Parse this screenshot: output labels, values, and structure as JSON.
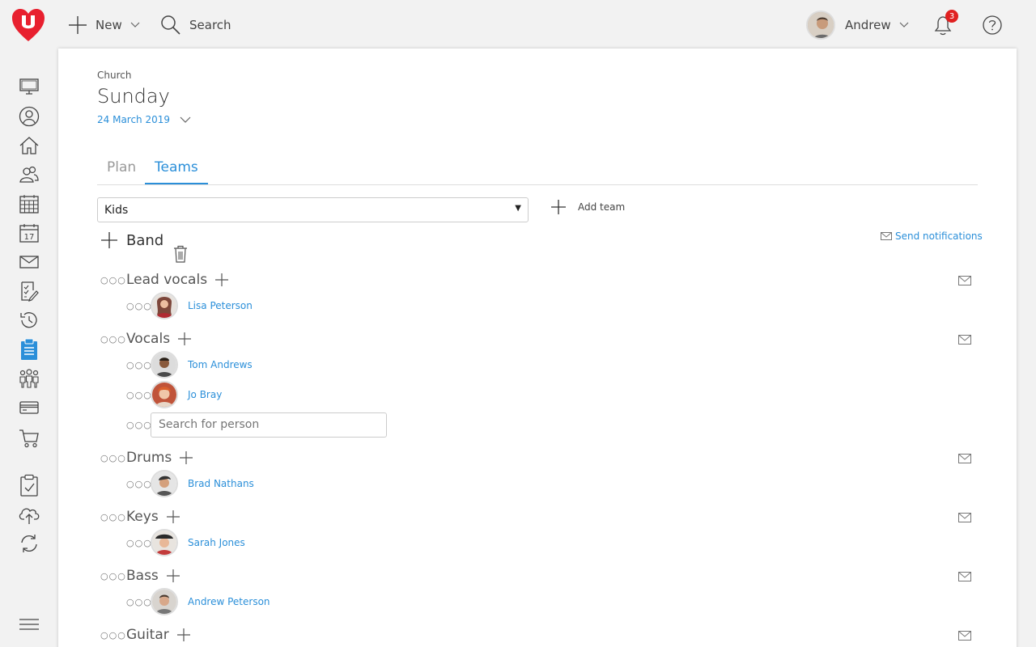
{
  "topbar": {
    "new_label": "New",
    "search_label": "Search",
    "user_name": "Andrew",
    "notification_count": "3"
  },
  "header": {
    "breadcrumb": "Church",
    "title": "Sunday",
    "date": "24 March 2019"
  },
  "tabs": [
    {
      "label": "Plan",
      "active": false
    },
    {
      "label": "Teams",
      "active": true
    }
  ],
  "team_select": {
    "value": "Kids"
  },
  "add_team_label": "Add team",
  "team_name": "Band",
  "send_notifications_label": "Send notifications",
  "roles": [
    {
      "name": "Lead vocals",
      "people": [
        "Lisa Peterson"
      ]
    },
    {
      "name": "Vocals",
      "people": [
        "Tom Andrews",
        "Jo Bray"
      ],
      "search_placeholder": "Search for person"
    },
    {
      "name": "Drums",
      "people": [
        "Brad Nathans"
      ]
    },
    {
      "name": "Keys",
      "people": [
        "Sarah Jones"
      ]
    },
    {
      "name": "Bass",
      "people": [
        "Andrew Peterson"
      ]
    },
    {
      "name": "Guitar",
      "people": []
    }
  ],
  "colors": {
    "accent": "#2b8fd9",
    "brand": "#e8202f",
    "badge": "#e02020"
  },
  "sidebar_icons": [
    "monitor-icon",
    "person-icon",
    "home-icon",
    "people-icon",
    "calendar-grid-icon",
    "calendar-17-icon",
    "mail-icon",
    "checklist-edit-icon",
    "history-icon",
    "clipboard-icon",
    "group-icon",
    "card-icon",
    "cart-icon",
    "clipboard-check-icon",
    "cloud-upload-icon",
    "sync-icon",
    "menu-icon"
  ]
}
